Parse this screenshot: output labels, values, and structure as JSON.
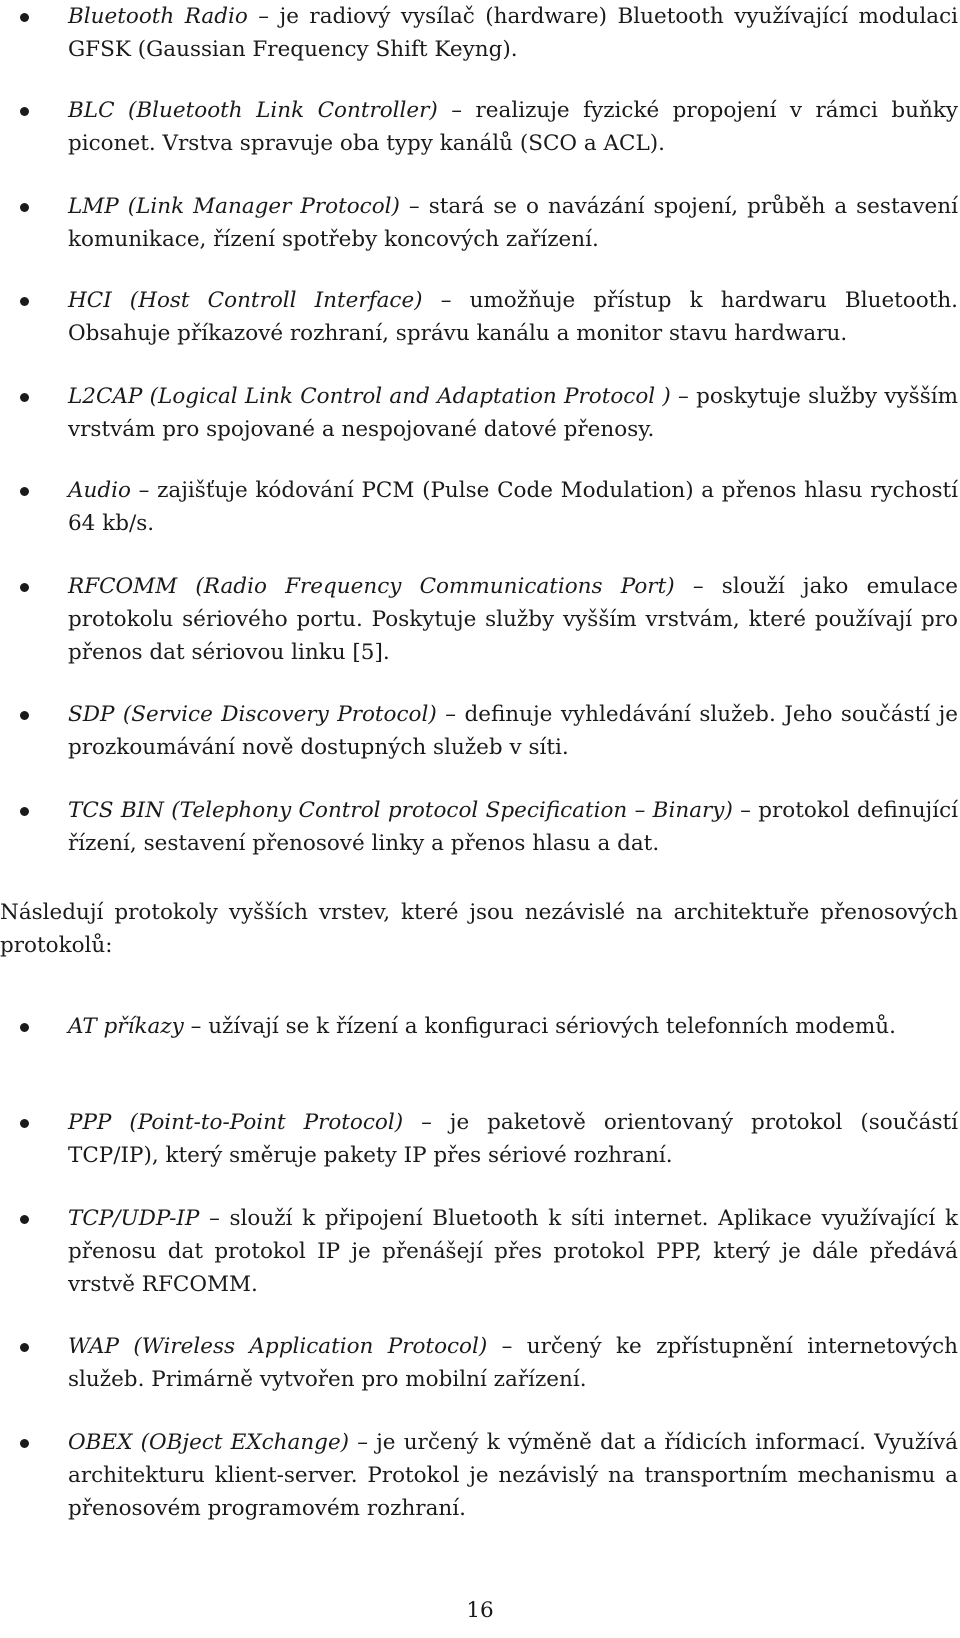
{
  "list1": [
    {
      "term": "Bluetooth Radio",
      "desc": "je radiový vysílač (hardware) Bluetooth využívající modulaci GFSK (Gaussian Frequency Shift Keyng)."
    },
    {
      "term": "BLC (Bluetooth Link Controller)",
      "desc": "realizuje fyzické propojení v rámci buňky piconet. Vrstva spravuje oba typy kanálů (SCO a ACL)."
    },
    {
      "term": "LMP (Link Manager Protocol)",
      "desc": "stará se o navázání spojení, průběh a sestavení komunikace, řízení spotřeby koncových zařízení."
    },
    {
      "term": "HCI (Host Controll Interface)",
      "desc": "umožňuje přístup k hardwaru Bluetooth. Obsahuje příkazové rozhraní, správu kanálu a monitor stavu hardwaru."
    },
    {
      "term": "L2CAP (Logical Link Control and Adaptation Protocol )",
      "desc": "poskytuje služby vyšším vrstvám pro spojované a nespojované datové přenosy."
    },
    {
      "term": "Audio",
      "desc": "zajišťuje kódování PCM (Pulse Code Modulation) a přenos hlasu rychostí 64 kb/s."
    },
    {
      "term": "RFCOMM (Radio Frequency Communications Port)",
      "desc": "slouží jako emulace protokolu sériového portu. Poskytuje služby vyšším vrstvám, které používají pro přenos dat sériovou linku [5]."
    },
    {
      "term": "SDP (Service Discovery Protocol)",
      "desc": "definuje vyhledávání služeb. Jeho součástí je prozkoumávání nově dostupných služeb v síti."
    },
    {
      "term": "TCS BIN (Telephony Control protocol Specification – Binary)",
      "desc": "protokol definující řízení, sestavení přenosové linky a přenos hlasu a dat."
    }
  ],
  "intro_paragraph": "Následují protokoly vyšších vrstev, které jsou nezávislé na architektuře přenosových protokolů:",
  "list2": [
    {
      "term": "AT příkazy",
      "desc": "užívají se k řízení a konfiguraci sériových telefonních modemů."
    },
    {
      "term": "PPP (Point-to-Point Protocol)",
      "desc": "je paketově orientovaný protokol (součástí TCP/IP), který směruje pakety IP přes sériové rozhraní."
    },
    {
      "term": "TCP/UDP-IP",
      "desc": "slouží k připojení Bluetooth k síti internet. Aplikace využívající k přenosu dat protokol IP je přenášejí přes protokol PPP, který je dále předává vrstvě RFCOMM."
    },
    {
      "term": "WAP (Wireless Application Protocol)",
      "desc": "určený ke zpřístupnění internetových služeb. Primárně vytvořen pro mobilní zařízení."
    },
    {
      "term": "OBEX (OBject EXchange)",
      "desc": "je určený k výměně dat a řídicích informací. Využívá architekturu klient-server. Protokol je nezávislý na transportním mechanismu a přenosovém programovém rozhraní."
    }
  ],
  "separator": " – ",
  "page_number": "16"
}
